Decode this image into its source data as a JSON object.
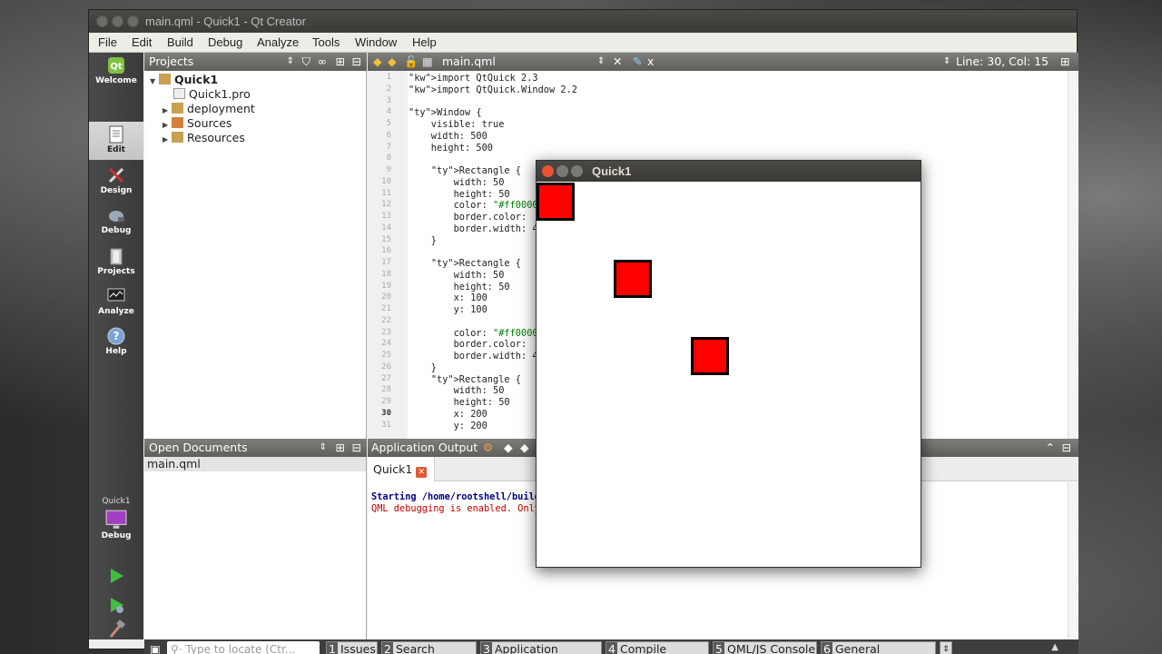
{
  "window": {
    "title": "main.qml - Quick1 - Qt Creator"
  },
  "menu": [
    "File",
    "Edit",
    "Build",
    "Debug",
    "Analyze",
    "Tools",
    "Window",
    "Help"
  ],
  "modes": [
    "Welcome",
    "Edit",
    "Design",
    "Debug",
    "Projects",
    "Analyze",
    "Help"
  ],
  "target": {
    "project": "Quick1",
    "mode": "Debug"
  },
  "projects": {
    "header": "Projects",
    "tree": [
      {
        "label": "Quick1"
      },
      {
        "label": "Quick1.pro"
      },
      {
        "label": "deployment"
      },
      {
        "label": "Sources"
      },
      {
        "label": "Resources"
      }
    ]
  },
  "open_documents": {
    "header": "Open Documents",
    "items": [
      "main.qml"
    ]
  },
  "editor": {
    "filename": "main.qml",
    "symbol": "x",
    "position": "Line: 30, Col: 15",
    "lines": [
      {
        "n": "1",
        "text": "import QtQuick 2.3"
      },
      {
        "n": "2",
        "text": "import QtQuick.Window 2.2"
      },
      {
        "n": "3",
        "text": ""
      },
      {
        "n": "4",
        "text": "Window {"
      },
      {
        "n": "5",
        "text": "    visible: true"
      },
      {
        "n": "6",
        "text": "    width: 500"
      },
      {
        "n": "7",
        "text": "    height: 500"
      },
      {
        "n": "8",
        "text": ""
      },
      {
        "n": "9",
        "text": "    Rectangle {"
      },
      {
        "n": "10",
        "text": "        width: 50"
      },
      {
        "n": "11",
        "text": "        height: 50"
      },
      {
        "n": "12",
        "text": "        color: \"#ff0000"
      },
      {
        "n": "13",
        "text": "        border.color:"
      },
      {
        "n": "14",
        "text": "        border.width: 4"
      },
      {
        "n": "15",
        "text": "    }"
      },
      {
        "n": "16",
        "text": ""
      },
      {
        "n": "17",
        "text": "    Rectangle {"
      },
      {
        "n": "18",
        "text": "        width: 50"
      },
      {
        "n": "19",
        "text": "        height: 50"
      },
      {
        "n": "20",
        "text": "        x: 100"
      },
      {
        "n": "21",
        "text": "        y: 100"
      },
      {
        "n": "22",
        "text": ""
      },
      {
        "n": "23",
        "text": "        color: \"#ff0000"
      },
      {
        "n": "24",
        "text": "        border.color:"
      },
      {
        "n": "25",
        "text": "        border.width: 4"
      },
      {
        "n": "26",
        "text": "    }"
      },
      {
        "n": "27",
        "text": "    Rectangle {"
      },
      {
        "n": "28",
        "text": "        width: 50"
      },
      {
        "n": "29",
        "text": "        height: 50"
      },
      {
        "n": "30",
        "text": "        x: 200"
      },
      {
        "n": "31",
        "text": "        y: 200"
      }
    ]
  },
  "app_output": {
    "header": "Application Output",
    "tab": "Quick1",
    "lines": [
      "Starting /home/rootshell/build",
      "QML debugging is enabled. Only"
    ]
  },
  "statusbar": {
    "locate_placeholder": "Type to locate (Ctr...",
    "panes": [
      {
        "num": "1",
        "label": "Issues"
      },
      {
        "num": "2",
        "label": "Search Results"
      },
      {
        "num": "3",
        "label": "Application Output"
      },
      {
        "num": "4",
        "label": "Compile Output"
      },
      {
        "num": "5",
        "label": "QML/JS Console"
      },
      {
        "num": "6",
        "label": "General Messages"
      }
    ]
  },
  "quick_window": {
    "title": "Quick1",
    "rect_color": "#ff0000"
  }
}
